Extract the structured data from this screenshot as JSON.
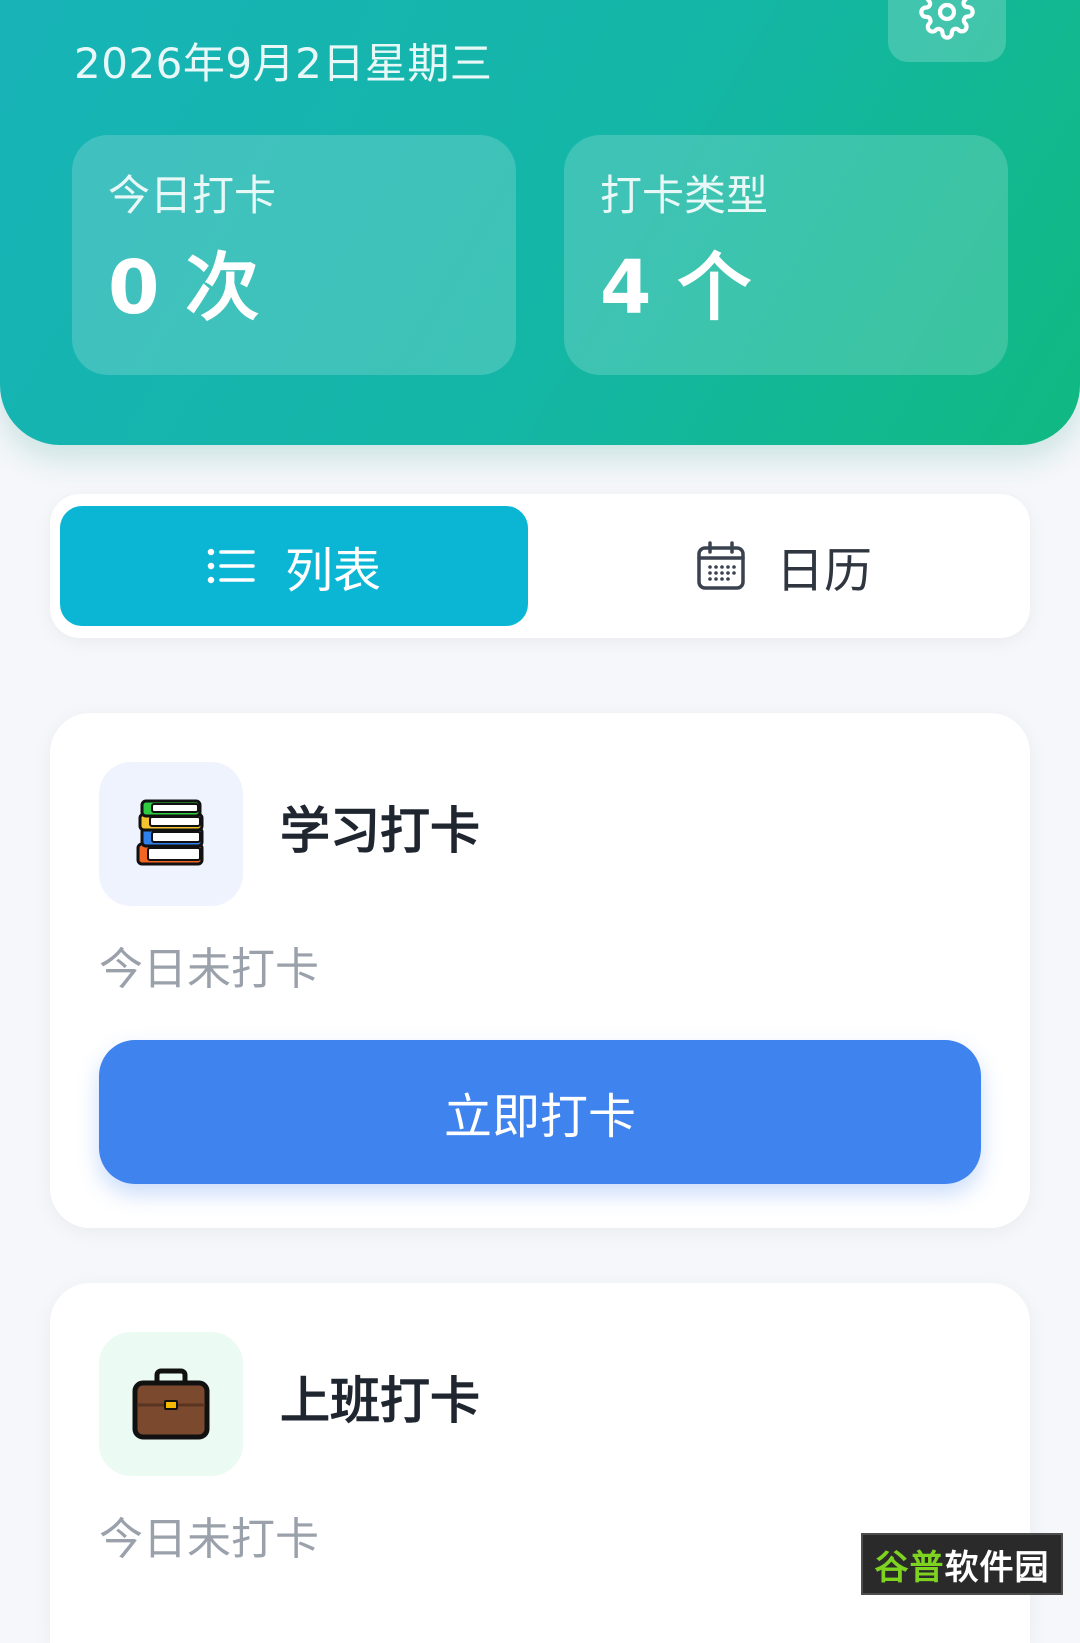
{
  "header": {
    "date": "2026年9月2日星期三",
    "settings_icon": "gear-icon",
    "stats": [
      {
        "label": "今日打卡",
        "value": "0 次"
      },
      {
        "label": "打卡类型",
        "value": "4 个"
      }
    ]
  },
  "view_toggle": {
    "list_label": "列表",
    "list_icon": "list-icon",
    "calendar_label": "日历",
    "calendar_icon": "calendar-icon",
    "active": "list"
  },
  "tasks": [
    {
      "name": "学习打卡",
      "icon": "books-icon",
      "status": "今日未打卡",
      "button": "立即打卡"
    },
    {
      "name": "上班打卡",
      "icon": "briefcase-icon",
      "status": "今日未打卡"
    }
  ],
  "watermark": {
    "part1": "谷普",
    "part2": "软件园"
  },
  "colors": {
    "header_gradient_start": "#17b3b7",
    "header_gradient_end": "#10b981",
    "active_tab": "#0bb6d4",
    "primary_button": "#3f83ee",
    "status_text": "#9aa1ab"
  }
}
